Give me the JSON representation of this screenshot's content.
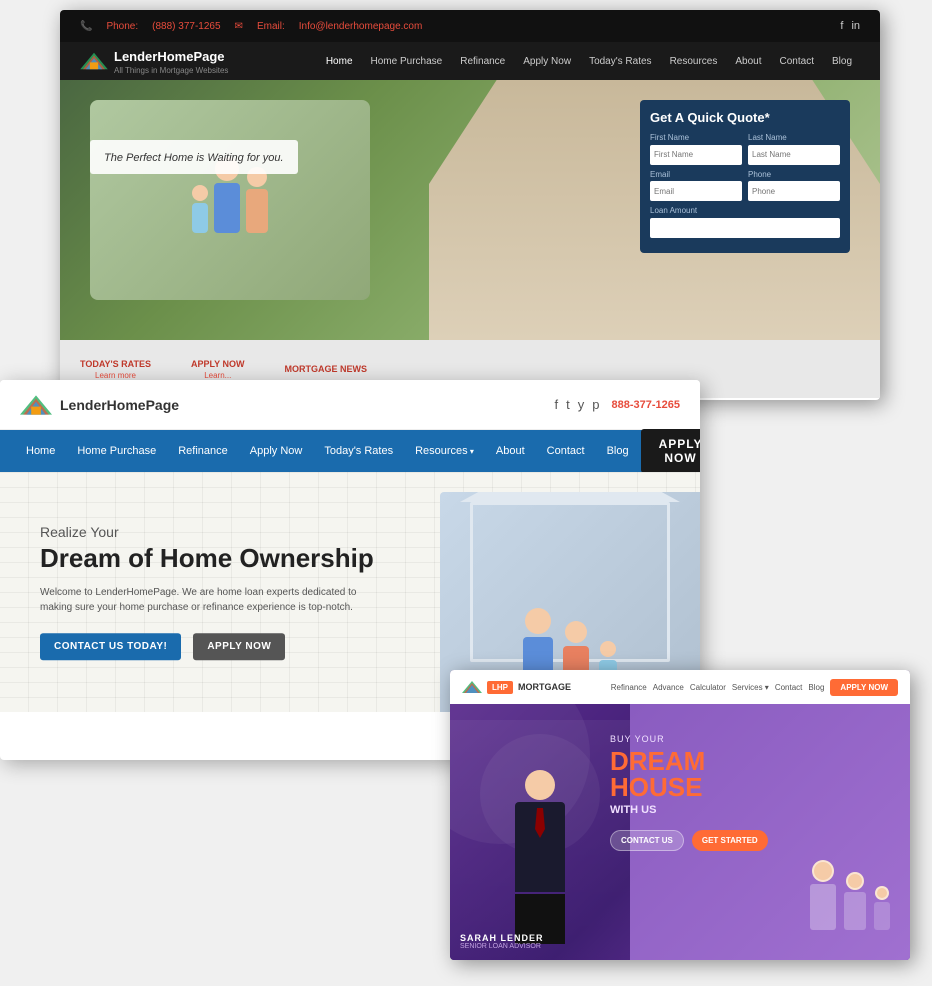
{
  "screenshot1": {
    "topbar": {
      "phone_label": "Phone:",
      "phone_number": "(888) 377-1265",
      "email_label": "Email:",
      "email_address": "Info@lenderhomepage.com"
    },
    "nav": {
      "brand": "LenderHomePage",
      "brand_sub": "All Things in Mortgage Websites",
      "links": [
        "Home",
        "Home Purchase",
        "Refinance",
        "Apply Now",
        "Today's Rates",
        "Resources",
        "About",
        "Contact",
        "Blog"
      ]
    },
    "hero": {
      "tagline": "The Perfect Home is Waiting for you.",
      "form_title": "Get A Quick Quote*",
      "form_fields": {
        "first_name_label": "First Name",
        "first_name_placeholder": "First Name",
        "last_name_label": "Last Name",
        "last_name_placeholder": "Last Name",
        "email_label": "Email",
        "email_placeholder": "Email",
        "phone_label": "Phone",
        "phone_placeholder": "Phone",
        "loan_label": "Loan Amount"
      }
    },
    "bottom": {
      "items": [
        {
          "title": "TODAY'S RATES",
          "link": "Learn more"
        },
        {
          "title": "APPLY NOW",
          "link": "Learn..."
        },
        {
          "title": "MORTGAGE NEWS",
          "link": ""
        }
      ]
    }
  },
  "screenshot2": {
    "brand": "LenderHomePage",
    "phone": "888-377-1265",
    "nav": {
      "links": [
        "Home",
        "Home Purchase",
        "Refinance",
        "Apply Now",
        "Today's Rates",
        "Resources",
        "About",
        "Contact",
        "Blog"
      ],
      "apply_btn": "APPLY NOW"
    },
    "hero": {
      "subtitle": "Realize Your",
      "title": "Dream of Home Ownership",
      "description": "Welcome to LenderHomePage. We are home loan experts dedicated to making sure your home purchase or refinance experience is top-notch.",
      "btn_contact": "CONTACT US TODAY!",
      "btn_apply": "APPLY NOW"
    }
  },
  "screenshot3": {
    "logo_badge": "LHP",
    "logo_text": "MORTGAGE",
    "nav": {
      "links": [
        "Refinance",
        "Advance",
        "Calculator",
        "Services",
        "Contact",
        "Blog"
      ],
      "apply_btn": "APPLY NOW"
    },
    "hero": {
      "sup": "BUY YOUR",
      "title_line1": "DREAM",
      "title_line2": "HOUSE",
      "title_with": "WITH US",
      "btn_contact": "CONTACT US",
      "btn_started": "GET STARTED"
    },
    "agent": {
      "name": "SARAH LENDER",
      "title": "SENIOR LOAN ADVISOR"
    }
  }
}
